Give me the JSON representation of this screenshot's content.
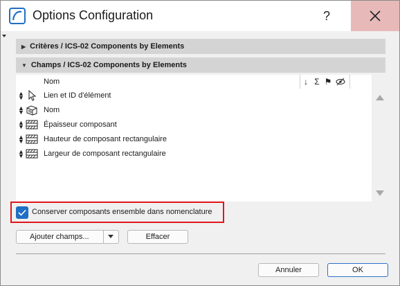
{
  "window": {
    "title": "Options Configuration",
    "help_label": "?"
  },
  "sections": [
    {
      "label": "Critères / ICS-02 Components by Elements",
      "expanded": false
    },
    {
      "label": "Champs / ICS-02 Components by Elements",
      "expanded": true
    }
  ],
  "list": {
    "header": {
      "name_label": "Nom",
      "icons": [
        "sort-down-arrow-icon",
        "sum-icon",
        "flag-icon",
        "hidden-eye-icon"
      ]
    },
    "rows": [
      {
        "label": "Lien et ID d'élément",
        "icon": "cursor-arrow-icon"
      },
      {
        "label": "Nom",
        "icon": "layers-cube-icon"
      },
      {
        "label": "Épaisseur composant",
        "icon": "hatched-layers-icon"
      },
      {
        "label": "Hauteur de composant rectangulaire",
        "icon": "hatched-layers-icon"
      },
      {
        "label": "Largeur de composant rectangulaire",
        "icon": "hatched-layers-icon"
      }
    ]
  },
  "options": {
    "keep_together_label": "Conserver composants ensemble dans nomenclature",
    "keep_together_checked": true
  },
  "buttons": {
    "add_fields": "Ajouter champs...",
    "clear": "Effacer",
    "cancel": "Annuler",
    "ok": "OK"
  },
  "colors": {
    "accent": "#1f6fc4",
    "highlight_frame": "#e0151a",
    "close_hover": "#e8b9b9",
    "section_bg": "#d4d4d4"
  }
}
